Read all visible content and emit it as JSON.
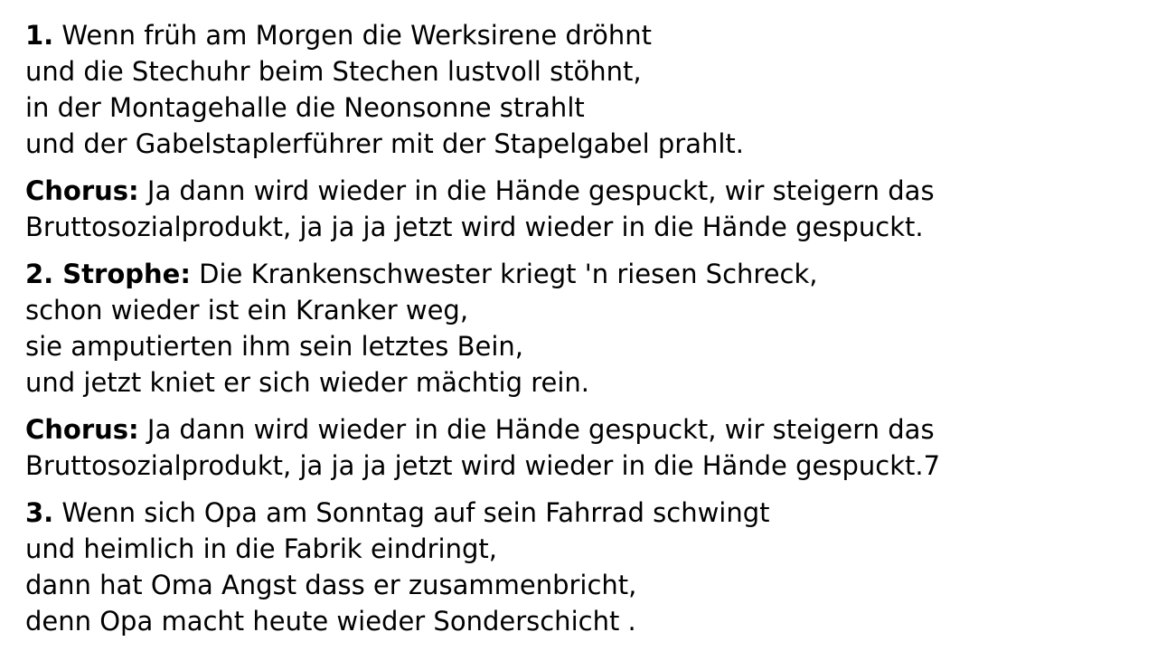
{
  "lyrics": {
    "verse1": {
      "label": "1.",
      "lines": [
        "Wenn früh am Morgen die Werksirene dröhnt",
        "und die Stechuhr beim Stechen lustvoll stöhnt,",
        "in der Montagehalle die Neonsonne strahlt",
        "und der Gabelstaplerführer mit der Stapelgabel prahlt."
      ]
    },
    "chorus1": {
      "label": "Chorus:",
      "lines": [
        "Ja dann wird wieder in die Hände gespuckt, wir steigern das",
        "Bruttosozialprodukt, ja ja ja jetzt wird wieder in die Hände gespuckt."
      ]
    },
    "verse2": {
      "label": "2. Strophe:",
      "lines": [
        "Die Krankenschwester kriegt 'n riesen Schreck,",
        "schon wieder ist ein Kranker weg,",
        "sie amputierten ihm sein letztes Bein,",
        "und jetzt kniet er sich wieder mächtig rein."
      ]
    },
    "chorus2": {
      "label": "Chorus:",
      "lines": [
        "Ja dann wird wieder in die Hände gespuckt, wir steigern das",
        "Bruttosozialprodukt, ja ja ja jetzt wird wieder in die Hände gespuckt.7"
      ]
    },
    "verse3": {
      "label": "3.",
      "lines": [
        "Wenn sich Opa am Sonntag auf sein Fahrrad schwingt",
        "und heimlich in die Fabrik eindringt,",
        "dann hat Oma Angst dass er zusammenbricht,",
        "denn Opa macht heute wieder Sonderschicht ."
      ]
    }
  }
}
